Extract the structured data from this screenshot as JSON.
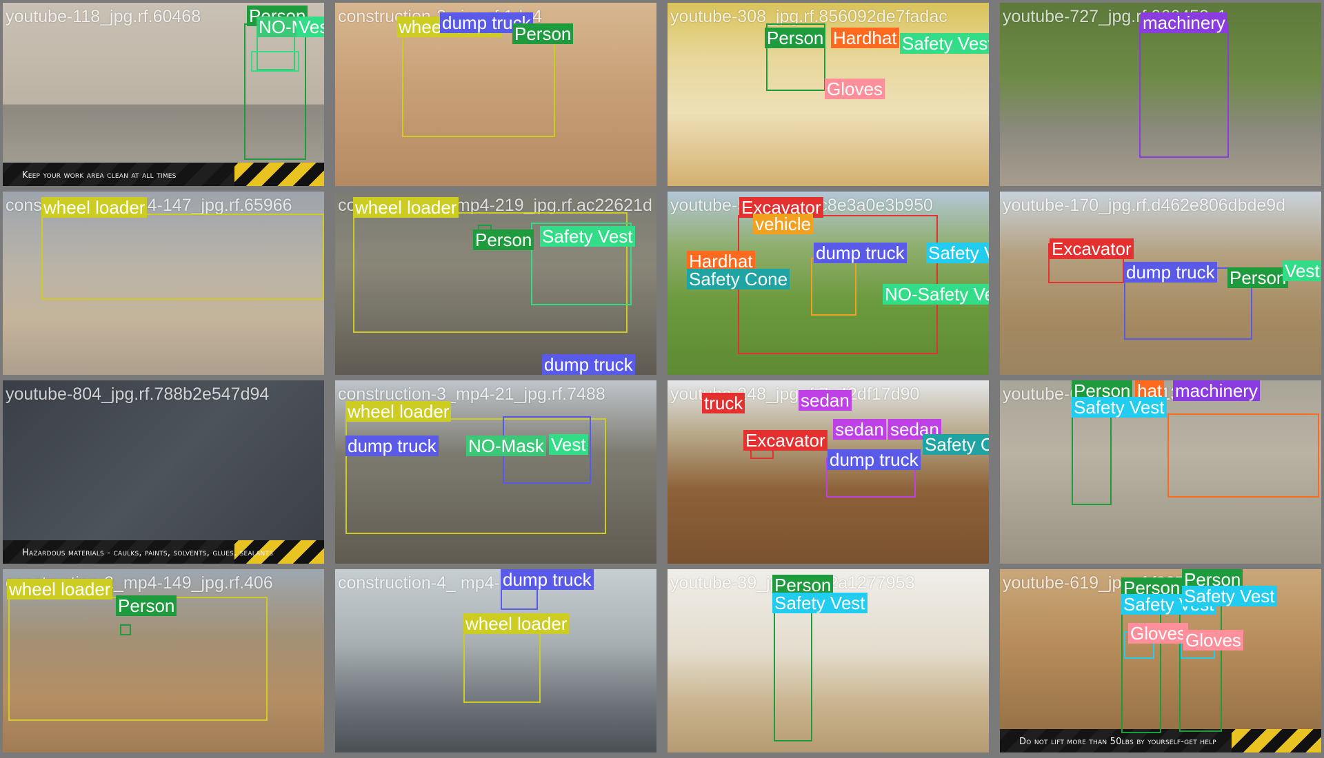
{
  "colors": {
    "Person": "#1e9b3c",
    "NO-Mask": "#3cc877",
    "Hardhat": "#ff6a1f",
    "Safety Vest": "#33dd88",
    "Gloves": "#ff8f9a",
    "wheel loader": "#cccc22",
    "dump truck": "#5a5ae8",
    "machinery": "#8a3ce0",
    "Excavator": "#e53030",
    "vehicle": "#f2a020",
    "Safety Cone": "#1fa3a3",
    "sedan": "#c040e8",
    "NO-Safety Vest": "#33dd88",
    "Safety Vest (cyan)": "#22ccee"
  },
  "tiles": [
    {
      "id": "t1",
      "bg": "linear-gradient(180deg,#c9c1b5 0%,#bdb3a4 55%,#8d8980 56%,#a9a397 100%)",
      "filename": "youtube-118_jpg.rf.60468",
      "caption": "Keep your work area clean at all times",
      "labels": [
        {
          "text": "Person",
          "color": "#1e9b3c"
        },
        {
          "text": "NO-Mask",
          "color": "#3cc877"
        },
        {
          "text": "Vest",
          "color": "#33dd88"
        }
      ]
    },
    {
      "id": "t2",
      "bg": "linear-gradient(180deg,#d7b790 0%,#caa27a 40%,#b48a63 100%)",
      "filename": "construction-3_ jpg.rf.1da4",
      "labels": [
        {
          "text": "wheel loader",
          "color": "#cccc22"
        },
        {
          "text": "dump truck",
          "color": "#5a5ae8"
        },
        {
          "text": "Person",
          "color": "#1e9b3c"
        }
      ]
    },
    {
      "id": "t3",
      "bg": "linear-gradient(180deg,#d9c35a 0%,#e7d79a 30%,#eee0b8 60%,#d4b070 100%)",
      "filename": "youtube-308_jpg.rf.856092de7fadac",
      "labels": [
        {
          "text": "Person",
          "color": "#1e9b3c"
        },
        {
          "text": "Hardhat",
          "color": "#ff6a1f"
        },
        {
          "text": "Safety Vest",
          "color": "#33dd88"
        },
        {
          "text": "Gloves",
          "color": "#ff8f9a"
        }
      ]
    },
    {
      "id": "t4",
      "bg": "linear-gradient(180deg,#5d7a3b 0%,#6d8a45 40%,#8c8a80 70%,#a79d8e 100%)",
      "filename": "youtube-727_jpg.rf.066452c1",
      "labels": [
        {
          "text": "machinery",
          "color": "#8a3ce0"
        }
      ]
    },
    {
      "id": "t5",
      "bg": "linear-gradient(180deg,#9da4ad 0%,#b9b3a8 40%,#c5b49b 70%,#ad9f8d 100%)",
      "filename": "construction-4_mp4-147_jpg.rf.65966",
      "labels": [
        {
          "text": "wheel loader",
          "color": "#cccc22"
        }
      ]
    },
    {
      "id": "t6",
      "bg": "linear-gradient(180deg,#7c7c74 0%,#8a8779 40%,#5f5b52 100%)",
      "filename": "construction-3_mp4-219_jpg.rf.ac22621d",
      "labels": [
        {
          "text": "wheel loader",
          "color": "#cccc22"
        },
        {
          "text": "Person",
          "color": "#1e9b3c"
        },
        {
          "text": "Safety Vest",
          "color": "#33dd88"
        },
        {
          "text": "dump truck",
          "color": "#5a5ae8"
        }
      ]
    },
    {
      "id": "t7",
      "bg": "linear-gradient(180deg,#b4c6d8 0%,#8fae6e 30%,#6c9a3e 60%,#5d8a33 100%)",
      "filename": "youtube-58_jpg.rf.4c8e3a0e3b950",
      "labels": [
        {
          "text": "Excavator",
          "color": "#e53030"
        },
        {
          "text": "vehicle",
          "color": "#f2a020"
        },
        {
          "text": "Hardhat",
          "color": "#ff6a1f"
        },
        {
          "text": "Safety Cone",
          "color": "#1fa3a3"
        },
        {
          "text": "dump truck",
          "color": "#5a5ae8"
        },
        {
          "text": "Safety Vest",
          "color": "#22ccee"
        },
        {
          "text": "NO-Safety Vest",
          "color": "#33dd88"
        }
      ]
    },
    {
      "id": "t8",
      "bg": "linear-gradient(180deg,#c8d2dc 0%,#b4a07e 35%,#a58a62 70%,#9b8460 100%)",
      "filename": "youtube-170_jpg.rf.d462e806dbde9d",
      "labels": [
        {
          "text": "Excavator",
          "color": "#e53030"
        },
        {
          "text": "dump truck",
          "color": "#5a5ae8"
        },
        {
          "text": "Person",
          "color": "#1e9b3c"
        },
        {
          "text": "Vest",
          "color": "#33dd88"
        }
      ]
    },
    {
      "id": "t9",
      "bg": "linear-gradient(135deg,#3a3f47 0%,#4d535b 50%,#3a3e44 100%)",
      "filename": "youtube-804_jpg.rf.788b2e547d94",
      "caption": "Hazardous materials - caulks, paints, solvents, glues, sealants",
      "labels": []
    },
    {
      "id": "t10",
      "bg": "linear-gradient(180deg,#bfc5cc 0%,#7d7b70 40%,#605b50 100%)",
      "filename": "construction-3_mp4-21_jpg.rf.7488",
      "labels": [
        {
          "text": "wheel loader",
          "color": "#cccc22"
        },
        {
          "text": "dump truck",
          "color": "#5a5ae8"
        },
        {
          "text": "NO-Mask",
          "color": "#3cc877"
        },
        {
          "text": "Vest",
          "color": "#33dd88"
        }
      ]
    },
    {
      "id": "t11",
      "bg": "linear-gradient(180deg,#e4e7ea 0%,#b6a787 30%,#8d6138 60%,#7a5230 100%)",
      "filename": "youtube-248_jpg.rf.7e42df17d90",
      "labels": [
        {
          "text": "truck",
          "color": "#e53030"
        },
        {
          "text": "sedan",
          "color": "#c040e8"
        },
        {
          "text": "Excavator",
          "color": "#e53030"
        },
        {
          "text": "sedan",
          "color": "#c040e8"
        },
        {
          "text": "sedan",
          "color": "#c040e8"
        },
        {
          "text": "Safety Cone",
          "color": "#1fa3a3"
        },
        {
          "text": "dump truck",
          "color": "#5a5ae8"
        }
      ]
    },
    {
      "id": "t12",
      "bg": "linear-gradient(180deg,#a9a598 0%,#b9b3a4 40%,#9a9383 100%)",
      "filename": "youtube-617_jpg.rf.6131cdcfc484",
      "labels": [
        {
          "text": "Person",
          "color": "#1e9b3c"
        },
        {
          "text": "hat",
          "color": "#ff6a1f"
        },
        {
          "text": "machinery",
          "color": "#8a3ce0"
        },
        {
          "text": "Safety Vest",
          "color": "#22ccee"
        }
      ]
    },
    {
      "id": "t13",
      "bg": "linear-gradient(180deg,#9ea7b1 0%,#a29177 35%,#b58e64 70%,#a07c55 100%)",
      "filename": "construction-2_mp4-149_jpg.rf.406",
      "labels": [
        {
          "text": "wheel loader",
          "color": "#cccc22"
        },
        {
          "text": "Person",
          "color": "#1e9b3c"
        }
      ]
    },
    {
      "id": "t14",
      "bg": "linear-gradient(180deg,#c7ced2 0%,#a9b0b3 40%,#6b7177 75%,#4a5054 100%)",
      "filename": "construction-4_ mp4-",
      "labels": [
        {
          "text": "dump truck",
          "color": "#5a5ae8"
        },
        {
          "text": "wheel loader",
          "color": "#cccc22"
        }
      ]
    },
    {
      "id": "t15",
      "bg": "linear-gradient(180deg,#f0eee9 0%,#e3dccd 45%,#c9b28c 75%,#b59b72 100%)",
      "filename": "youtube-39_jpg.rf.1d2a1277953",
      "labels": [
        {
          "text": "Person",
          "color": "#1e9b3c"
        },
        {
          "text": "Safety Vest",
          "color": "#22ccee"
        }
      ]
    },
    {
      "id": "t16",
      "bg": "linear-gradient(180deg,#c9a77a 0%,#b88d5b 40%,#8f6b42 100%)",
      "filename": "youtube-619_jpg.rf.f8879aa",
      "caption": "Do not lift more than 50lbs by yourself-get help",
      "labels": [
        {
          "text": "Person",
          "color": "#1e9b3c"
        },
        {
          "text": "Person",
          "color": "#1e9b3c"
        },
        {
          "text": "Safety Vest",
          "color": "#22ccee"
        },
        {
          "text": "Safety Vest",
          "color": "#22ccee"
        },
        {
          "text": "Gloves",
          "color": "#ff8f9a"
        },
        {
          "text": "Gloves",
          "color": "#ff8f9a"
        }
      ]
    }
  ]
}
